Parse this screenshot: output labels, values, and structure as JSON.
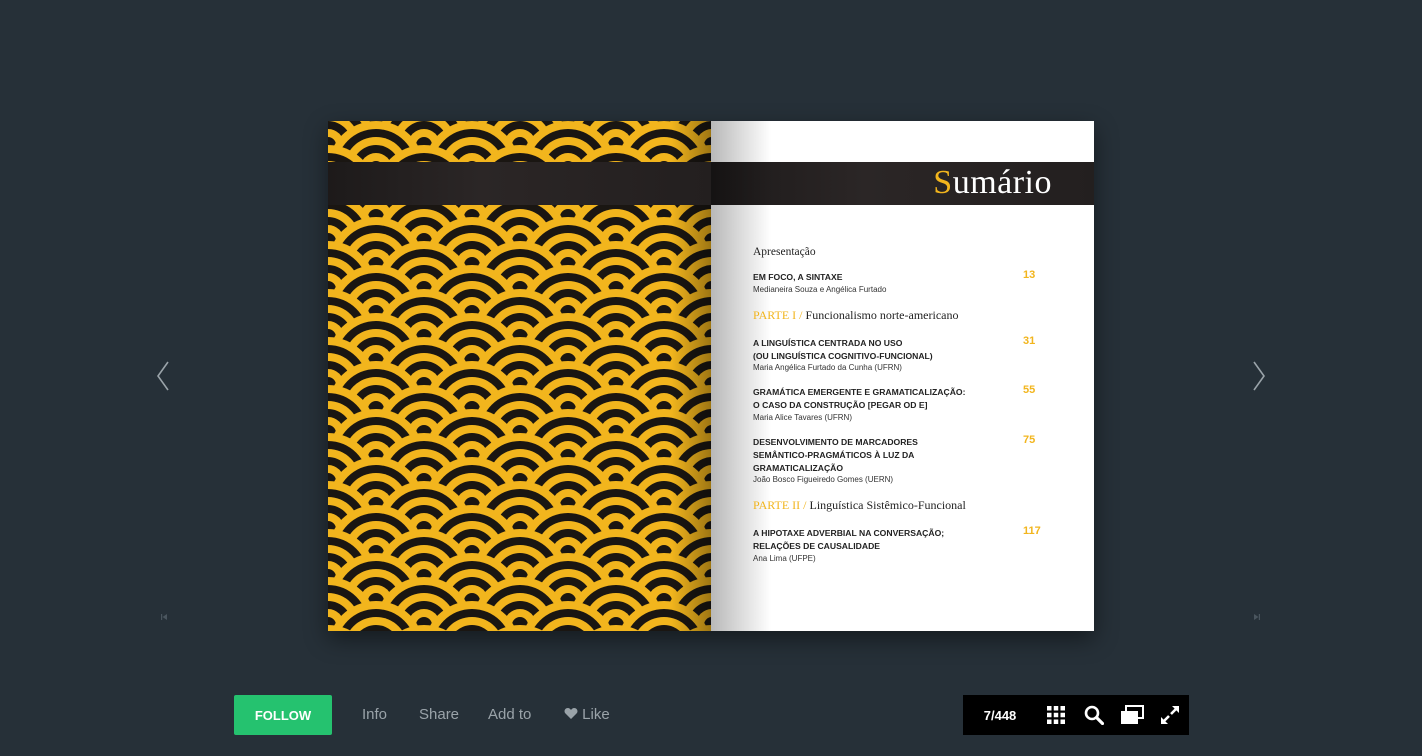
{
  "book": {
    "title": "Sumário",
    "title_initial": "S",
    "title_rest": "umário",
    "toc": {
      "presentation": "Apresentação",
      "entries_intro": [
        {
          "title": "EM FOCO, A SINTAXE",
          "author": "Medianeira Souza e Angélica Furtado",
          "page": "13"
        }
      ],
      "part1": {
        "label": "PARTE I /",
        "title": "Funcionalismo norte-americano"
      },
      "entries_part1": [
        {
          "title": "A LINGUÍSTICA CENTRADA NO USO\n(OU LINGUÍSTICA COGNITIVO-FUNCIONAL)",
          "author": "Maria Angélica Furtado da Cunha (UFRN)",
          "page": "31"
        },
        {
          "title": "GRAMÁTICA EMERGENTE E GRAMATICALIZAÇÃO:\nO CASO DA CONSTRUÇÃO [PEGAR OD E]",
          "author": "Maria Alice Tavares (UFRN)",
          "page": "55"
        },
        {
          "title": "DESENVOLVIMENTO DE MARCADORES\nSEMÂNTICO-PRAGMÁTICOS À LUZ DA\nGRAMATICALIZAÇÃO",
          "author": "João Bosco Figueiredo Gomes (UERN)",
          "page": "75"
        }
      ],
      "part2": {
        "label": "PARTE II /",
        "title": "Linguística Sistêmico-Funcional"
      },
      "entries_part2": [
        {
          "title": "A HIPOTAXE ADVERBIAL NA CONVERSAÇÃO;\nRELAÇÕES DE CAUSALIDADE",
          "author": "Ana Lima (UFPE)",
          "page": "117"
        }
      ]
    }
  },
  "nav": {
    "prev_icon": "chevron-left-icon",
    "next_icon": "chevron-right-icon"
  },
  "actions": {
    "follow": "FOLLOW",
    "info": "Info",
    "share": "Share",
    "add_to": "Add to",
    "like": "Like"
  },
  "toolbar": {
    "page_current": "7",
    "page_total": "/448"
  },
  "colors": {
    "background": "#263038",
    "accent": "#f2b51d",
    "follow": "#25c26f",
    "toolbar": "#000000"
  }
}
